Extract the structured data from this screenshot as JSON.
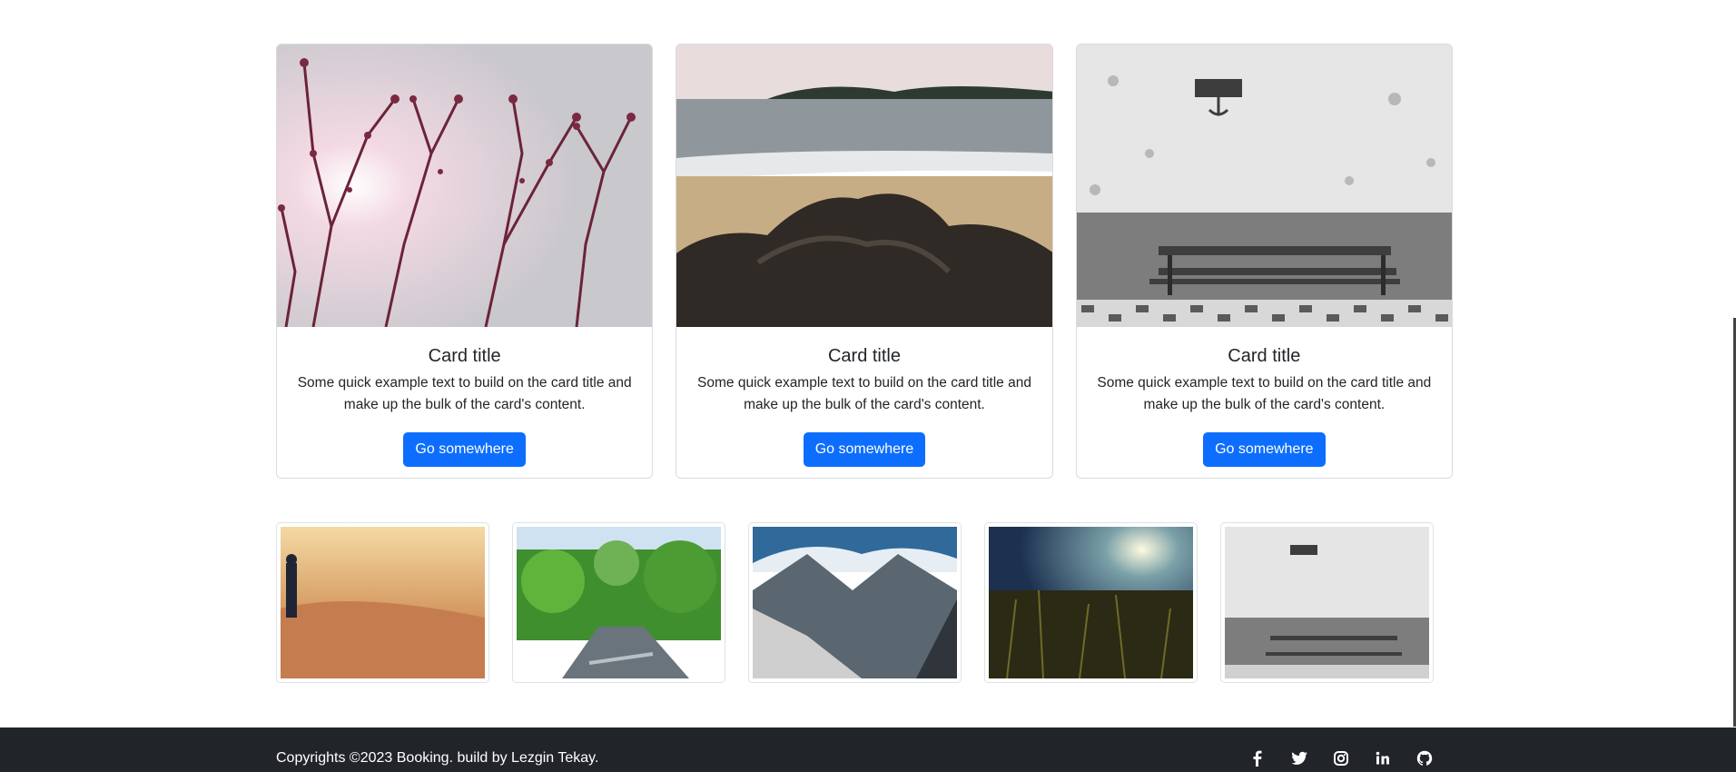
{
  "cards": [
    {
      "title": "Card title",
      "text": "Some quick example text to build on the card title and make up the bulk of the card's content.",
      "button": "Go somewhere",
      "image": "branches-sunlight"
    },
    {
      "title": "Card title",
      "text": "Some quick example text to build on the card title and make up the bulk of the card's content.",
      "button": "Go somewhere",
      "image": "beach-rocks"
    },
    {
      "title": "Card title",
      "text": "Some quick example text to build on the card title and make up the bulk of the card's content.",
      "button": "Go somewhere",
      "image": "bench-wall"
    }
  ],
  "thumbnails": [
    "person-coast",
    "forest-river",
    "mountains-snow",
    "grass-sunset",
    "bench-wall"
  ],
  "footer": {
    "copyright": "Copyrights ©2023 Booking. build by Lezgin Tekay.",
    "social_icons": [
      "facebook-icon",
      "twitter-icon",
      "instagram-icon",
      "linkedin-icon",
      "github-icon"
    ]
  },
  "colors": {
    "primary": "#0d6efd",
    "footer_bg": "#212529"
  }
}
